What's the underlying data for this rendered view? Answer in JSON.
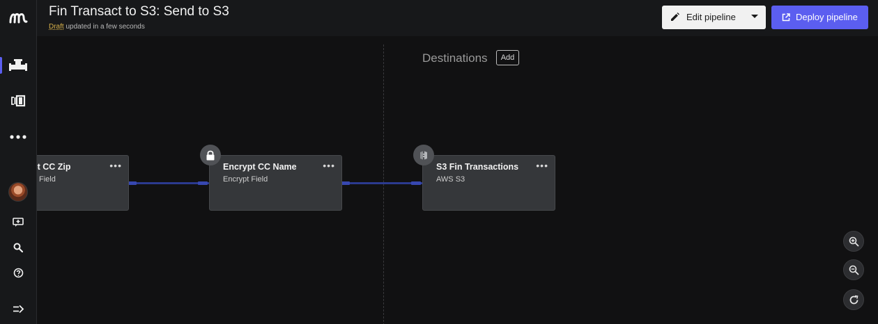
{
  "app": {
    "title": "Fin Transact to S3: Send to S3",
    "status_label": "Draft",
    "status_text": "updated in a few seconds"
  },
  "toolbar": {
    "edit_label": "Edit pipeline",
    "deploy_label": "Deploy pipeline"
  },
  "sidebar": {
    "items": [
      {
        "name": "pipelines",
        "icon": "pipeline-icon",
        "active": true
      },
      {
        "name": "library",
        "icon": "library-icon"
      },
      {
        "name": "more",
        "icon": "more-icon"
      },
      {
        "name": "avatar",
        "icon": "avatar"
      },
      {
        "name": "feedback",
        "icon": "feedback-icon"
      },
      {
        "name": "search",
        "icon": "search-icon"
      },
      {
        "name": "help",
        "icon": "help-icon"
      },
      {
        "name": "expand",
        "icon": "expand-icon"
      }
    ],
    "accent": "#5b5ef0"
  },
  "canvas": {
    "destinations_label": "Destinations",
    "add_label": "Add",
    "nodes": [
      {
        "title": "pt CC Zip",
        "subtitle": "Field",
        "icon": null
      },
      {
        "title": "Encrypt CC Name",
        "subtitle": "Encrypt Field",
        "icon": "lock-icon"
      },
      {
        "title": "S3 Fin Transactions",
        "subtitle": "AWS S3",
        "icon": "aws-s3-icon"
      }
    ],
    "zoom_controls": [
      "zoom-in-icon",
      "zoom-out-icon",
      "reset-icon"
    ]
  },
  "colors": {
    "background": "#111112",
    "node": "#35373a",
    "edge": "#2b3a8f",
    "deploy": "#5b5ef0",
    "draft": "#d9b24a"
  }
}
